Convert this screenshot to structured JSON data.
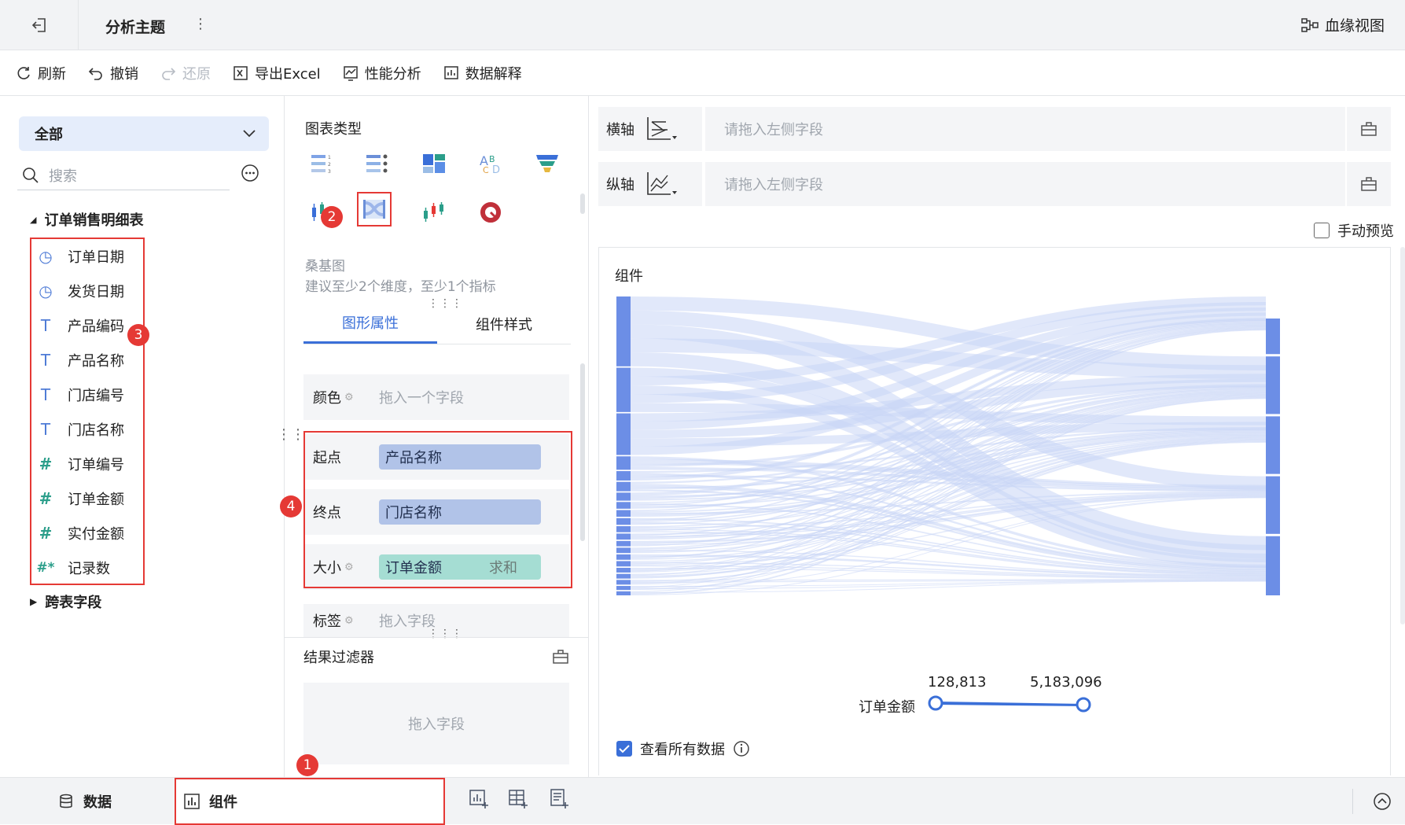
{
  "topbar": {
    "title": "分析主题",
    "more": "⋮",
    "lineage_label": "血缘视图"
  },
  "toolbar": {
    "refresh": "刷新",
    "undo": "撤销",
    "redo": "还原",
    "export": "导出Excel",
    "perf": "性能分析",
    "explain": "数据解释"
  },
  "left": {
    "scope": "全部",
    "search_placeholder": "搜索",
    "table_name": "订单销售明细表",
    "fields": [
      {
        "name": "订单日期",
        "type": "date"
      },
      {
        "name": "发货日期",
        "type": "date"
      },
      {
        "name": "产品编码",
        "type": "text"
      },
      {
        "name": "产品名称",
        "type": "text"
      },
      {
        "name": "门店编号",
        "type": "text"
      },
      {
        "name": "门店名称",
        "type": "text"
      },
      {
        "name": "订单编号",
        "type": "number"
      },
      {
        "name": "订单金额",
        "type": "number"
      },
      {
        "name": "实付金额",
        "type": "number"
      },
      {
        "name": "记录数",
        "type": "count"
      }
    ],
    "cross_fields": "跨表字段"
  },
  "middle": {
    "chart_type_heading": "图表类型",
    "selected_name": "桑基图",
    "selected_hint": "建议至少2个维度，至少1个指标",
    "tab_props": "图形属性",
    "tab_style": "组件样式",
    "color_label": "颜色",
    "color_placeholder": "拖入一个字段",
    "start_label": "起点",
    "start_value": "产品名称",
    "end_label": "终点",
    "end_value": "门店名称",
    "size_label": "大小",
    "size_value": "订单金额",
    "size_agg": "求和",
    "tag_label": "标签",
    "tag_placeholder": "拖入字段",
    "filter_heading": "结果过滤器",
    "filter_placeholder": "拖入字段"
  },
  "right": {
    "x_label": "横轴",
    "y_label": "纵轴",
    "axis_placeholder": "请拖入左侧字段",
    "manual_preview": "手动预览",
    "canvas_title": "组件",
    "legend_label": "订单金额",
    "legend_min": "128,813",
    "legend_max": "5,183,096",
    "check_all": "查看所有数据"
  },
  "bottom": {
    "data_tab": "数据",
    "comp_tab": "组件"
  },
  "badges": [
    "1",
    "2",
    "3",
    "4"
  ],
  "colors": {
    "accent": "#3a6fd8",
    "highlight": "#e53935",
    "sankey_node": "#6c8ee6",
    "sankey_link": "#c9d5f6"
  }
}
